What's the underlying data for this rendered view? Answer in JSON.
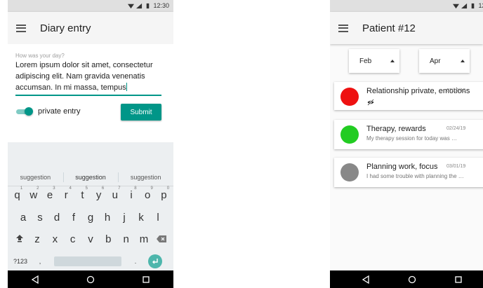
{
  "status_bar": {
    "time": "12:30"
  },
  "diary_screen": {
    "title": "Diary entry",
    "prompt": "How was your day?",
    "entry_text": "Lorem ipsum dolor sit amet, consectetur adipiscing elit. Nam gravida venenatis accumsan. In mi massa, tempus",
    "toggle_label": "private entry",
    "toggle_on": true,
    "submit_label": "Submit",
    "suggestions": [
      "suggestion",
      "suggestion",
      "suggestion"
    ],
    "keys": {
      "row1": [
        "q",
        "w",
        "e",
        "r",
        "t",
        "y",
        "u",
        "i",
        "o",
        "p"
      ],
      "row1_hints": [
        "1",
        "2",
        "3",
        "4",
        "5",
        "6",
        "7",
        "8",
        "9",
        "0"
      ],
      "row2": [
        "a",
        "s",
        "d",
        "f",
        "g",
        "h",
        "j",
        "k",
        "l"
      ],
      "row3": [
        "z",
        "x",
        "c",
        "v",
        "b",
        "n",
        "m"
      ],
      "symbols": "?123",
      "comma": ",",
      "period": "."
    }
  },
  "patient_screen": {
    "title": "Patient #12",
    "month_from": "Feb",
    "month_to": "Apr",
    "entries": [
      {
        "title": "Relationship private, emotions",
        "date": "02/12/19",
        "preview": "",
        "color": "#ee1111",
        "private_icon": "eye-off-icon"
      },
      {
        "title": "Therapy, rewards",
        "date": "02/24/19",
        "preview": "My therapy session for today was …",
        "color": "#22cc22"
      },
      {
        "title": "Planning work, focus",
        "date": "03/01/19",
        "preview": "I had some trouble with planning the …",
        "color": "#888888"
      }
    ]
  },
  "colors": {
    "accent": "#009688",
    "navbar": "#000000",
    "statusbar": "#e0e0e0"
  }
}
